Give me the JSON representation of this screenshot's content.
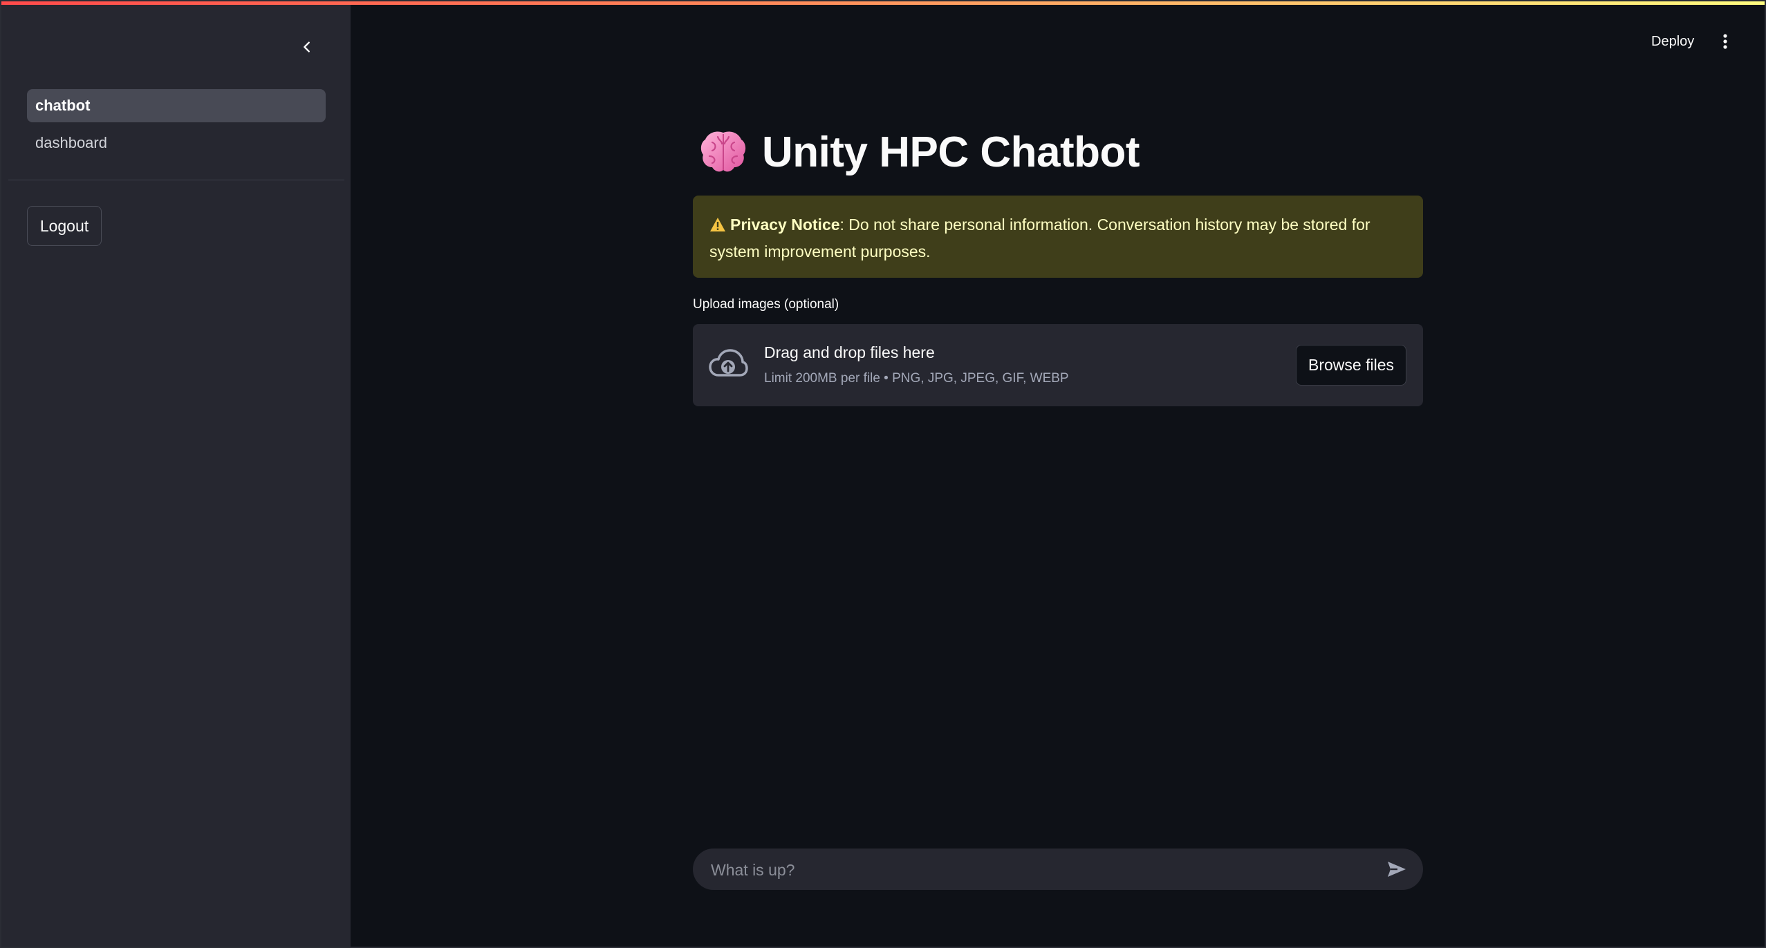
{
  "app": {
    "title": "Unity HPC Chatbot",
    "colors": {
      "background": "#0e1117",
      "sidebar": "#262730",
      "accent": "#ff4b4b",
      "warning_bg": "#3f3e1a",
      "warning_text": "#ffffc2"
    }
  },
  "sidebar": {
    "collapse_icon": "chevron-left-icon",
    "nav_items": [
      {
        "label": "chatbot",
        "active": true
      },
      {
        "label": "dashboard",
        "active": false
      }
    ],
    "logout_label": "Logout"
  },
  "header": {
    "deploy_label": "Deploy",
    "menu_icon": "kebab-menu-icon"
  },
  "main": {
    "title_icon": "brain-icon",
    "title": "Unity HPC Chatbot",
    "privacy_notice": {
      "icon": "warning-icon",
      "heading": "Privacy Notice",
      "text": ": Do not share personal information. Conversation history may be stored for system improvement purposes."
    },
    "uploader": {
      "label": "Upload images (optional)",
      "icon": "cloud-upload-icon",
      "drop_title": "Drag and drop files here",
      "drop_subtitle": "Limit 200MB per file • PNG, JPG, JPEG, GIF, WEBP",
      "browse_label": "Browse files"
    },
    "chat": {
      "placeholder": "What is up?",
      "value": "",
      "send_icon": "send-icon"
    }
  }
}
